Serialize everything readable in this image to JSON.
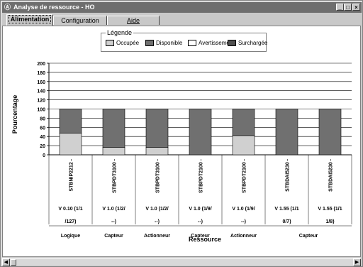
{
  "window": {
    "title": "Analyse de ressource - HO",
    "icon": "app-icon"
  },
  "tabs": [
    {
      "label": "Alimentation",
      "active": true
    },
    {
      "label": "Configuration",
      "active": false
    },
    {
      "label": "Aide",
      "active": false
    }
  ],
  "legend": {
    "title": "Légende",
    "items": [
      {
        "label": "Occupée",
        "color": "#d0d0d0"
      },
      {
        "label": "Disponible",
        "color": "#707070"
      },
      {
        "label": "Avertissement",
        "color": "#ffffff"
      },
      {
        "label": "Surchargée",
        "color": "#505050"
      }
    ]
  },
  "chart_data": {
    "type": "bar",
    "stacked": true,
    "ylabel": "Pourcentage",
    "xlabel": "Ressource",
    "ylim": [
      0,
      200
    ],
    "yticks": [
      0,
      20,
      40,
      60,
      80,
      100,
      120,
      140,
      160,
      180,
      200
    ],
    "grid": true,
    "categories": [
      {
        "name": "STBNIP2212 -",
        "version": [
          "V 0.10 (1/1",
          "/127)"
        ]
      },
      {
        "name": "STBPDT3100 -",
        "version": [
          "V 1.0 (1/2/",
          "--)"
        ]
      },
      {
        "name": "STBPDT3100 -",
        "version": [
          "V 1.0 (1/2/",
          "--)"
        ]
      },
      {
        "name": "STBPDT2100 -",
        "version": [
          "V 1.0 (1/9/",
          "--)"
        ]
      },
      {
        "name": "STBPDT2100 -",
        "version": [
          "V 1.0 (1/9/",
          "--)"
        ]
      },
      {
        "name": "STBDAI5230 -",
        "version": [
          "V 1.55 (1/1",
          "0/7)"
        ]
      },
      {
        "name": "STBDAI5230 -",
        "version": [
          "V 1.55 (1/1",
          "1/8)"
        ]
      }
    ],
    "groups": [
      "Logique",
      "Capteur",
      "Actionneur",
      "Capteur",
      "Actionneur",
      "Capteur"
    ],
    "series": [
      {
        "name": "Occupée",
        "values": [
          47,
          16,
          16,
          0,
          42,
          0,
          0
        ]
      },
      {
        "name": "Disponible",
        "values": [
          53,
          84,
          84,
          100,
          58,
          100,
          100
        ]
      }
    ]
  }
}
